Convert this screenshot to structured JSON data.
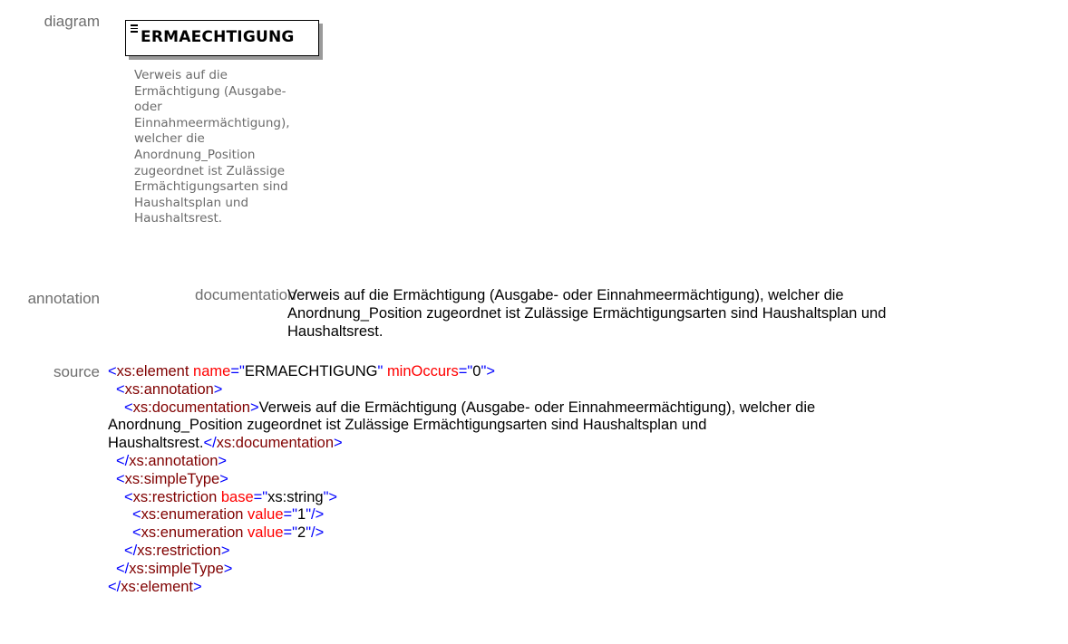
{
  "labels": {
    "diagram": "diagram",
    "annotation": "annotation",
    "source": "source",
    "documentation": "documentation"
  },
  "diagram": {
    "element_name": "ERMAECHTIGUNG",
    "doc_lines": [
      "Verweis auf die",
      "Ermächtigung (Ausgabe-",
      "oder",
      "Einnahmeermächtigung),",
      "welcher die",
      "Anordnung_Position",
      "zugeordnet ist Zulässige",
      "Ermächtigungsarten sind",
      "Haushaltsplan und",
      "Haushaltsrest."
    ]
  },
  "annotation": {
    "documentation_lines": [
      "Verweis auf die Ermächtigung (Ausgabe- oder Einnahmeermächtigung), welcher die",
      "Anordnung_Position zugeordnet ist Zulässige Ermächtigungsarten sind Haushaltsplan und",
      "Haushaltsrest."
    ]
  },
  "source": {
    "element_tag": "xs:element",
    "name_attr": "name",
    "name_value": "ERMAECHTIGUNG",
    "minoccurs_attr": "minOccurs",
    "minoccurs_value": "0",
    "annotation_tag": "xs:annotation",
    "documentation_tag": "xs:documentation",
    "doc_line1": "Verweis auf die Ermächtigung (Ausgabe- oder Einnahmeermächtigung), welcher die",
    "doc_line2": "Anordnung_Position zugeordnet ist Zulässige Ermächtigungsarten sind Haushaltsplan und",
    "doc_line3": "Haushaltsrest.",
    "simpletype_tag": "xs:simpleType",
    "restriction_tag": "xs:restriction",
    "base_attr": "base",
    "base_value": "xs:string",
    "enumeration_tag": "xs:enumeration",
    "value_attr": "value",
    "enum_values": [
      "1",
      "2"
    ]
  }
}
